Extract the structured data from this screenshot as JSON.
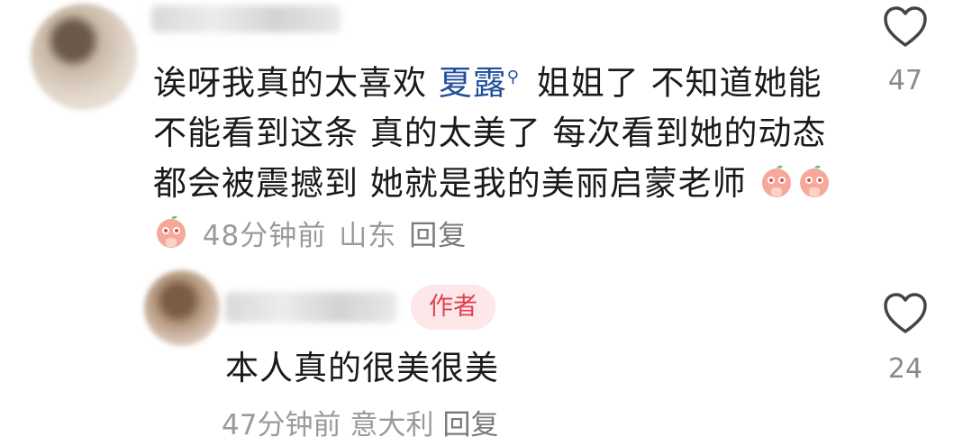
{
  "comment": {
    "text_before_mention": "诶呀我真的太喜欢 ",
    "mention": "夏露",
    "mention_icon": "search-icon",
    "text_after_mention": " 姐姐了 不知道她能不能看到这条 真的太美了 每次看到她的动态都会被震撼到 她就是我的美丽启蒙老师",
    "emojis": [
      "praying-face-emoji",
      "praying-face-emoji",
      "praying-face-emoji"
    ],
    "time": "48分钟前",
    "location": "山东",
    "reply_label": "回复",
    "likes": "47"
  },
  "reply": {
    "badge": "作者",
    "text": "本人真的很美很美",
    "time": "47分钟前",
    "location": "意大利",
    "reply_label": "回复",
    "likes": "24"
  },
  "colors": {
    "mention": "#1f4e9a",
    "badge_bg": "#fde7e8",
    "badge_text": "#e0414f",
    "meta": "#9a9a9a"
  }
}
